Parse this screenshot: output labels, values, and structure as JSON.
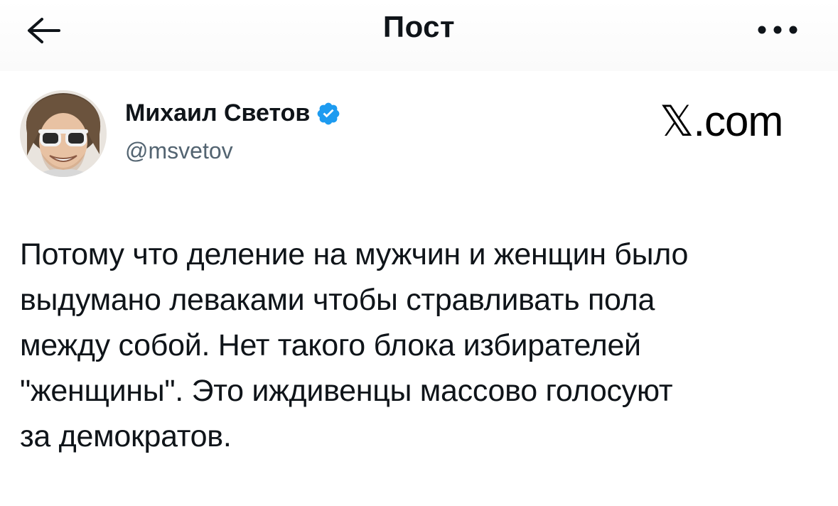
{
  "header": {
    "title": "Пост",
    "back_icon": "arrow-left-icon",
    "more_icon": "more-horizontal-icon"
  },
  "author": {
    "name": "Михаил Светов",
    "handle": "@msvetov",
    "verified": true,
    "verified_color": "#1d9bf0"
  },
  "brand": {
    "logo_text": "𝕏.com"
  },
  "post": {
    "text": "Потому что деление на мужчин и женщин было\nвыдумано леваками чтобы стравливать пола\nмежду собой. Нет такого блока избирателей\n\"женщины\". Это иждивенцы массово голосуют\nза демократов."
  }
}
